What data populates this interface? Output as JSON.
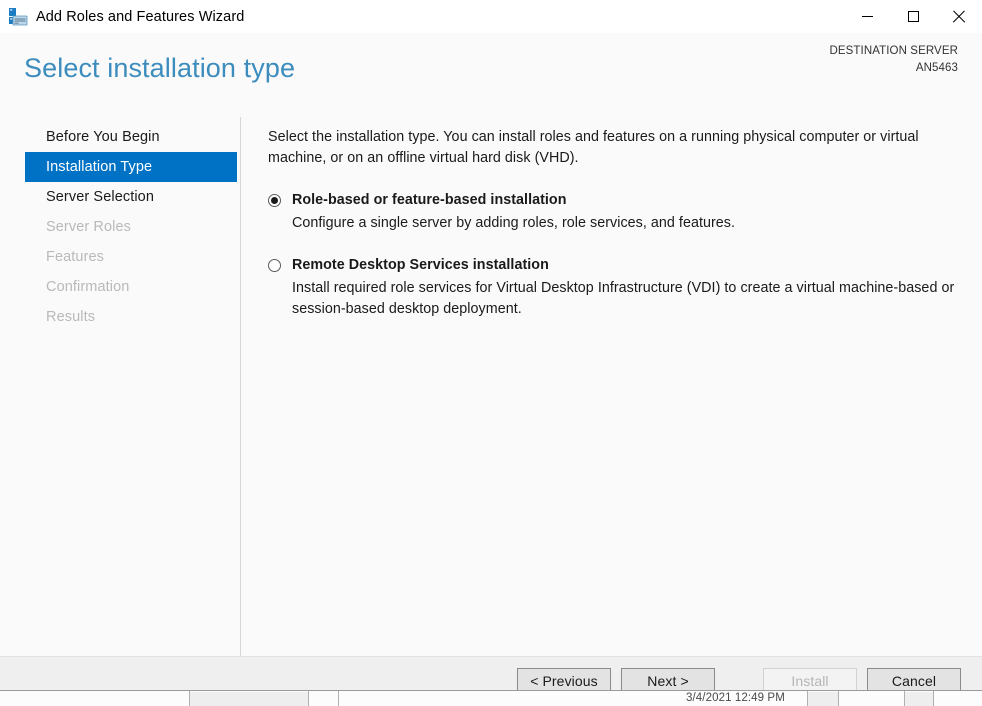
{
  "window": {
    "title": "Add Roles and Features Wizard",
    "icon": "server-wizard-icon",
    "controls": {
      "minimize": "minimize-icon",
      "maximize": "maximize-icon",
      "close": "close-icon"
    }
  },
  "header": {
    "page_title": "Select installation type",
    "destination_label": "DESTINATION SERVER",
    "destination_value": "AN5463",
    "title_color": "#3c8cbd"
  },
  "sidebar": {
    "items": [
      {
        "label": "Before You Begin",
        "state": "enabled"
      },
      {
        "label": "Installation Type",
        "state": "selected"
      },
      {
        "label": "Server Selection",
        "state": "enabled"
      },
      {
        "label": "Server Roles",
        "state": "disabled"
      },
      {
        "label": "Features",
        "state": "disabled"
      },
      {
        "label": "Confirmation",
        "state": "disabled"
      },
      {
        "label": "Results",
        "state": "disabled"
      }
    ],
    "selected_color": "#0072c6"
  },
  "content": {
    "intro": "Select the installation type. You can install roles and features on a running physical computer or virtual machine, or on an offline virtual hard disk (VHD).",
    "options": [
      {
        "label": "Role-based or feature-based installation",
        "description": "Configure a single server by adding roles, role services, and features.",
        "selected": true
      },
      {
        "label": "Remote Desktop Services installation",
        "description": "Install required role services for Virtual Desktop Infrastructure (VDI) to create a virtual machine-based or session-based desktop deployment.",
        "selected": false
      }
    ]
  },
  "footer": {
    "buttons": [
      {
        "label": "< Previous",
        "enabled": true
      },
      {
        "label": "Next >",
        "enabled": true
      },
      {
        "label": "Install",
        "enabled": false
      },
      {
        "label": "Cancel",
        "enabled": true
      }
    ]
  },
  "taskbar": {
    "clock": "3/4/2021 12:49 PM"
  }
}
